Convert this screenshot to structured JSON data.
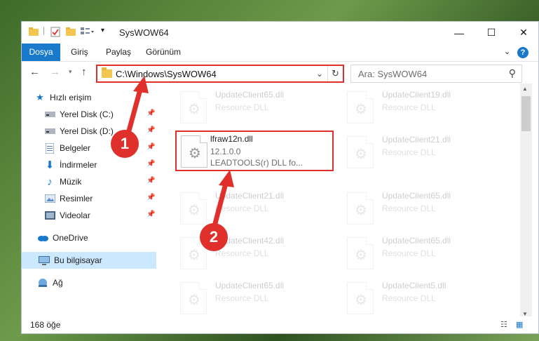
{
  "window": {
    "title": "SysWOW64"
  },
  "ribbon": {
    "tabs": [
      "Dosya",
      "Giriş",
      "Paylaş",
      "Görünüm"
    ],
    "help": "?"
  },
  "nav": {
    "address": "C:\\Windows\\SysWOW64",
    "search_placeholder": "Ara: SysWOW64"
  },
  "sidebar": {
    "items": [
      {
        "label": "Hızlı erişim",
        "icon": "star-icon"
      },
      {
        "label": "Yerel Disk (C:)",
        "icon": "drive-icon"
      },
      {
        "label": "Yerel Disk (D:)",
        "icon": "drive-icon"
      },
      {
        "label": "Belgeler",
        "icon": "documents-icon"
      },
      {
        "label": "İndirmeler",
        "icon": "download-icon"
      },
      {
        "label": "Müzik",
        "icon": "music-icon"
      },
      {
        "label": "Resimler",
        "icon": "pictures-icon"
      },
      {
        "label": "Videolar",
        "icon": "videos-icon"
      },
      {
        "label": "OneDrive",
        "icon": "cloud-icon"
      },
      {
        "label": "Bu bilgisayar",
        "icon": "computer-icon"
      },
      {
        "label": "Ağ",
        "icon": "network-icon"
      }
    ]
  },
  "files": {
    "left": [
      {
        "name": "UpdateClient65.dll",
        "meta1": "Resource DLL",
        "meta2": ""
      },
      {
        "name": "lfraw12n.dll",
        "meta1": "12.1.0.0",
        "meta2": "LEADTOOLS(r) DLL fo..."
      },
      {
        "name": "UpdateClient21.dll",
        "meta1": "Resource DLL",
        "meta2": ""
      },
      {
        "name": "UpdateClient42.dll",
        "meta1": "Resource DLL",
        "meta2": ""
      },
      {
        "name": "UpdateClient65.dll",
        "meta1": "Resource DLL",
        "meta2": ""
      }
    ],
    "right": [
      {
        "name": "UpdateClient19.dll",
        "meta1": "Resource DLL"
      },
      {
        "name": "UpdateClient21.dll",
        "meta1": "Resource DLL"
      },
      {
        "name": "UpdateClient65.dll",
        "meta1": "Resource DLL"
      },
      {
        "name": "UpdateClient65.dll",
        "meta1": "Resource DLL"
      },
      {
        "name": "UpdateClient5.dll",
        "meta1": "Resource DLL"
      }
    ]
  },
  "status": {
    "count": "168 öğe"
  },
  "annotations": {
    "callout1": "1",
    "callout2": "2"
  },
  "colors": {
    "accent": "#1979ca",
    "highlight": "#e0302b",
    "selected": "#cce8ff",
    "folder": "#f4c64f"
  }
}
